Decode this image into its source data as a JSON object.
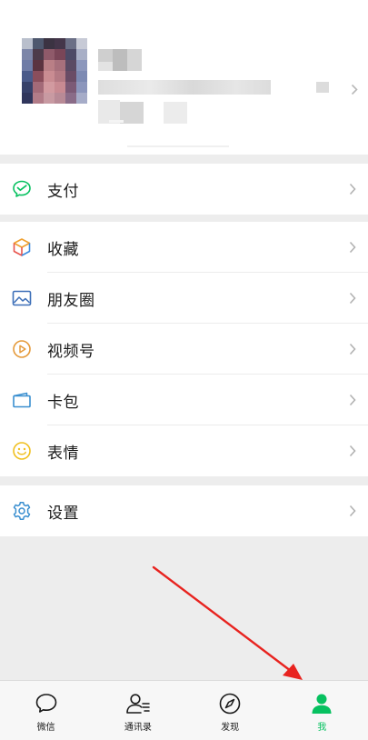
{
  "profile": {
    "name": "",
    "wechat_id": ""
  },
  "menu": {
    "pay": {
      "label": "支付",
      "icon": "wechat-pay-icon"
    },
    "favorites": {
      "label": "收藏",
      "icon": "favorites-cube-icon"
    },
    "moments": {
      "label": "朋友圈",
      "icon": "moments-picture-icon"
    },
    "channels": {
      "label": "视频号",
      "icon": "channels-play-icon"
    },
    "cards": {
      "label": "卡包",
      "icon": "card-wallet-icon"
    },
    "stickers": {
      "label": "表情",
      "icon": "smiley-icon"
    },
    "settings": {
      "label": "设置",
      "icon": "gear-icon"
    }
  },
  "tabbar": {
    "chats": {
      "label": "微信",
      "icon": "chat-bubble-icon"
    },
    "contacts": {
      "label": "通讯录",
      "icon": "contacts-icon"
    },
    "discover": {
      "label": "发现",
      "icon": "compass-icon"
    },
    "me": {
      "label": "我",
      "icon": "person-icon",
      "active": true
    }
  },
  "colors": {
    "accent_green": "#07c160",
    "annotation_arrow": "#e8231f",
    "background": "#ededed"
  }
}
